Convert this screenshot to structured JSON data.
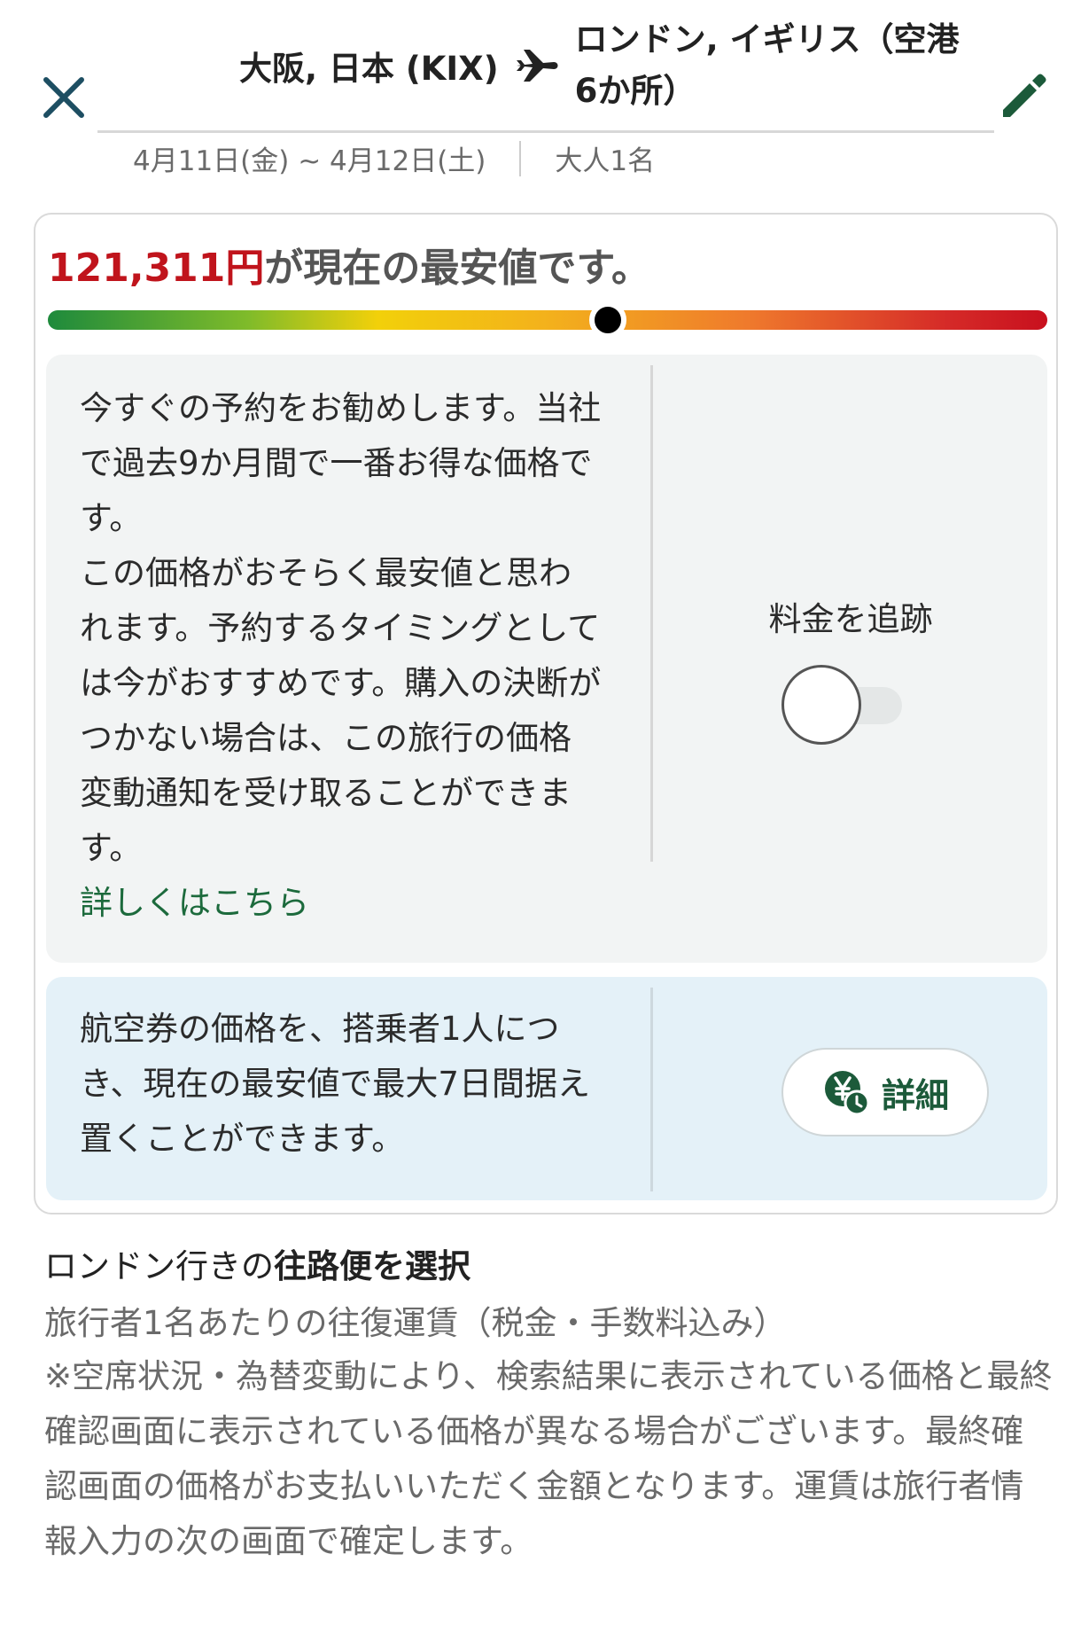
{
  "header": {
    "origin": "大阪, 日本 (KIX)",
    "destination": "ロンドン, イギリス（空港6か所）",
    "dates": "4月11日(金) ~ 4月12日(土)",
    "travelers": "大人1名"
  },
  "price_insight": {
    "price": "121,311円",
    "headline_suffix": "が現在の最安値です。",
    "gauge_position_fraction": 0.56,
    "advice_paragraphs": [
      "今すぐの予約をお勧めします。当社で過去9か月間で一番お得な価格です。",
      "この価格がおそらく最安値と思われます。予約するタイミングとしては今がおすすめです。購入の決断がつかない場合は、この旅行の価格変動通知を受け取ることができます。"
    ],
    "learn_more_link": "詳しくはこちら",
    "track_label": "料金を追跡",
    "track_enabled": false
  },
  "price_hold": {
    "text": "航空券の価格を、搭乗者1人につき、現在の最安値で最大7日間据え置くことができます。",
    "button_label": "詳細"
  },
  "flight_selection": {
    "title_regular": "ロンドン行きの",
    "title_bold": "往路便を選択",
    "fare_basis": "旅行者1名あたりの往復運賃（税金・手数料込み）",
    "disclaimer": "※空席状況・為替変動により、検索結果に表示されている価格と最終確認画面に表示されている価格が異なる場合がございます。最終確認画面の価格がお支払いいただく金額となります。運賃は旅行者情報入力の次の画面で確定します。"
  },
  "colors": {
    "brand_green": "#1c5a3a",
    "price_red": "#c0141c",
    "close_icon": "#1d4e62"
  }
}
